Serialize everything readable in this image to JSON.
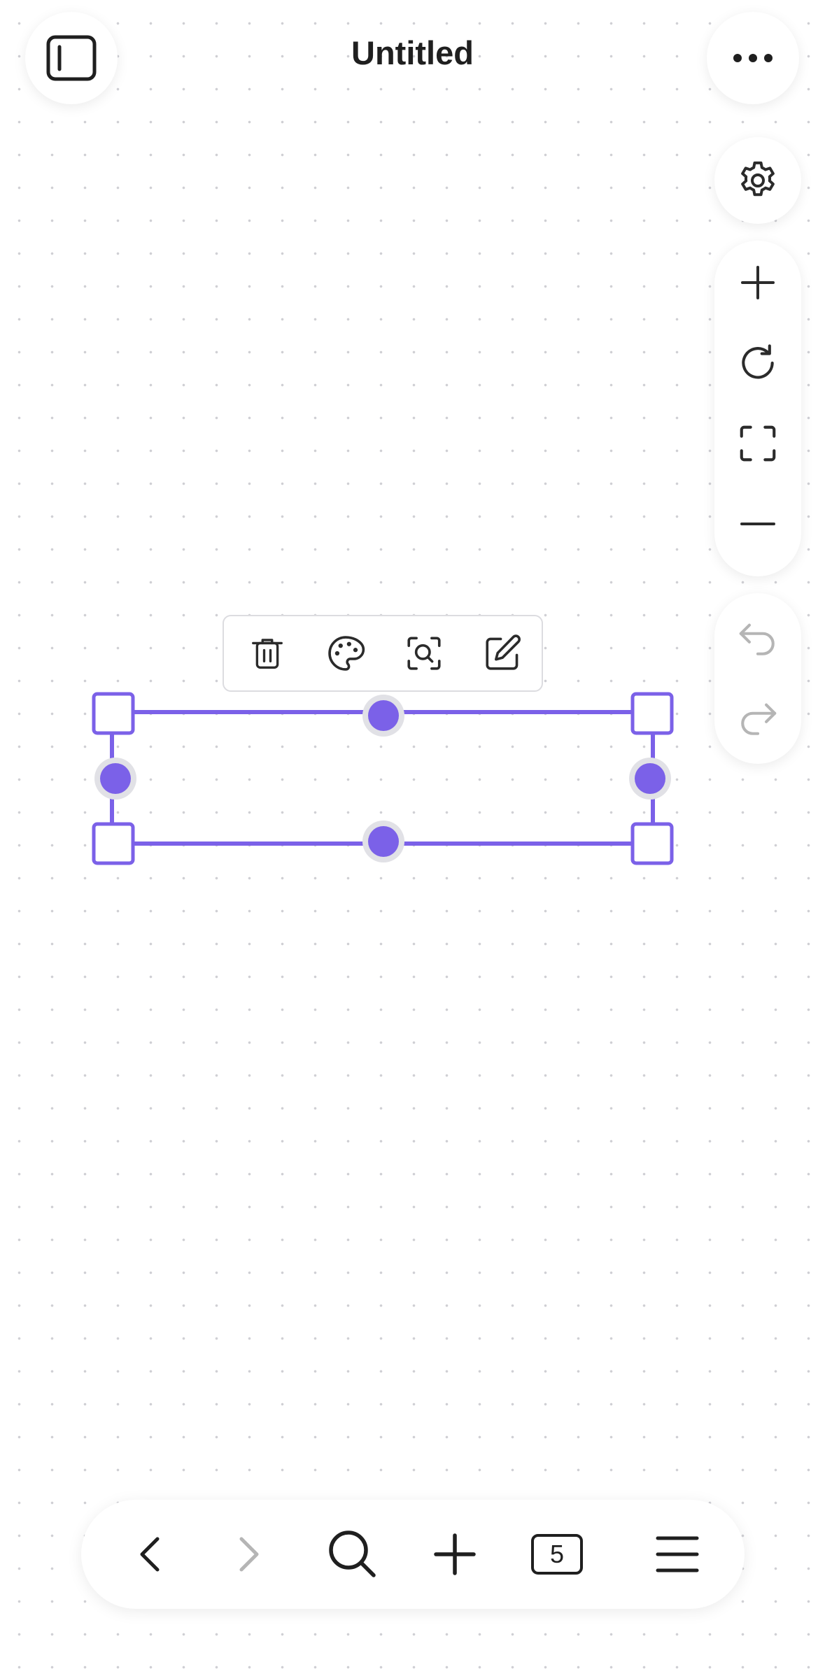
{
  "header": {
    "title": "Untitled",
    "sidebar_toggle_icon": "sidebar-toggle-icon",
    "more_icon": "more-horizontal-icon"
  },
  "right_toolbar": {
    "settings_icon": "gear-icon",
    "zoom_controls": [
      "plus-icon",
      "refresh-icon",
      "fit-screen-icon",
      "minus-icon"
    ],
    "history_controls": [
      "undo-icon",
      "redo-icon"
    ]
  },
  "context_toolbar": {
    "actions": [
      "trash-icon",
      "palette-icon",
      "zoom-to-selection-icon",
      "edit-icon"
    ]
  },
  "selection": {
    "accent_color": "#7b61e8"
  },
  "bottom_bar": {
    "back_icon": "chevron-left-icon",
    "forward_icon": "chevron-right-icon",
    "search_icon": "search-icon",
    "add_icon": "plus-icon",
    "page_count": "5",
    "menu_icon": "hamburger-menu-icon"
  },
  "colors": {
    "icon": "#2b2b2b",
    "icon_disabled": "#b5b5b5",
    "accent": "#7b61e8"
  }
}
